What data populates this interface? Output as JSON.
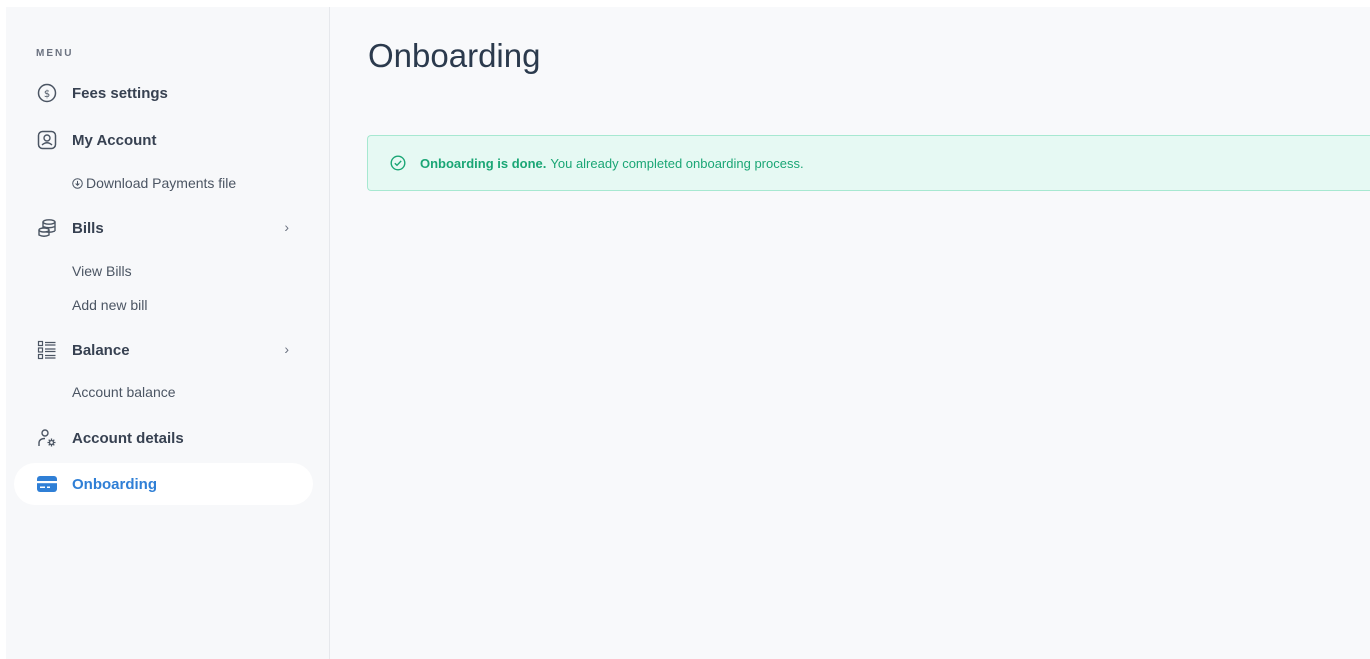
{
  "sidebar": {
    "menu_heading": "MENU",
    "items": [
      {
        "label": "Fees settings",
        "icon": "dollar-circle-icon"
      },
      {
        "label": "My Account",
        "icon": "user-square-icon"
      },
      {
        "label": "Bills",
        "icon": "coins-stack-icon"
      },
      {
        "label": "Balance",
        "icon": "list-icon"
      },
      {
        "label": "Account details",
        "icon": "user-settings-icon"
      },
      {
        "label": "Onboarding",
        "icon": "credit-card-icon",
        "active": true
      }
    ],
    "sub": {
      "download_payments": "Download Payments file",
      "view_bills": "View Bills",
      "add_new_bill": "Add new bill",
      "account_balance": "Account balance"
    },
    "chevron": "›"
  },
  "main": {
    "title": "Onboarding",
    "alert": {
      "strong": "Onboarding is done.",
      "text": "You already completed onboarding process."
    }
  },
  "colors": {
    "accent": "#2f7fd6",
    "success": "#1aa675",
    "success_bg": "#e6f9f3"
  }
}
